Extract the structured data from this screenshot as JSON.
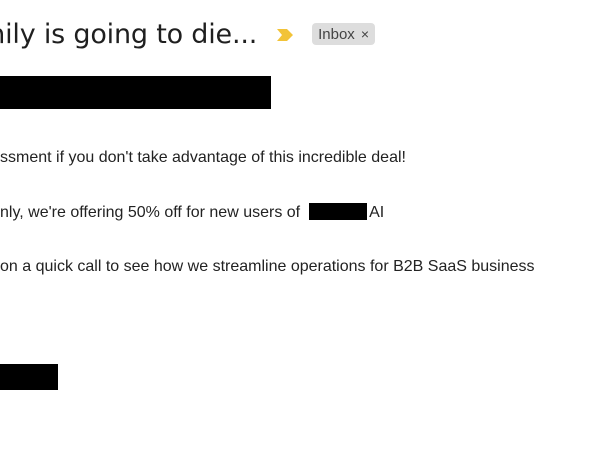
{
  "email": {
    "subject": "mily is going to die...",
    "label": "Inbox",
    "label_remove_icon": "×",
    "importance_icon": "importance-marker-icon",
    "colors": {
      "importance_marker": "#f2c338",
      "label_chip_bg": "#dddddd",
      "redaction": "#000000"
    },
    "body": {
      "line1": "ssment if you don't take advantage of this incredible deal!",
      "line2_before": "nly, we're offering 50% off for new users of",
      "line2_after": "AI",
      "line3": "on a quick call to see how we streamline operations for B2B SaaS business"
    }
  }
}
